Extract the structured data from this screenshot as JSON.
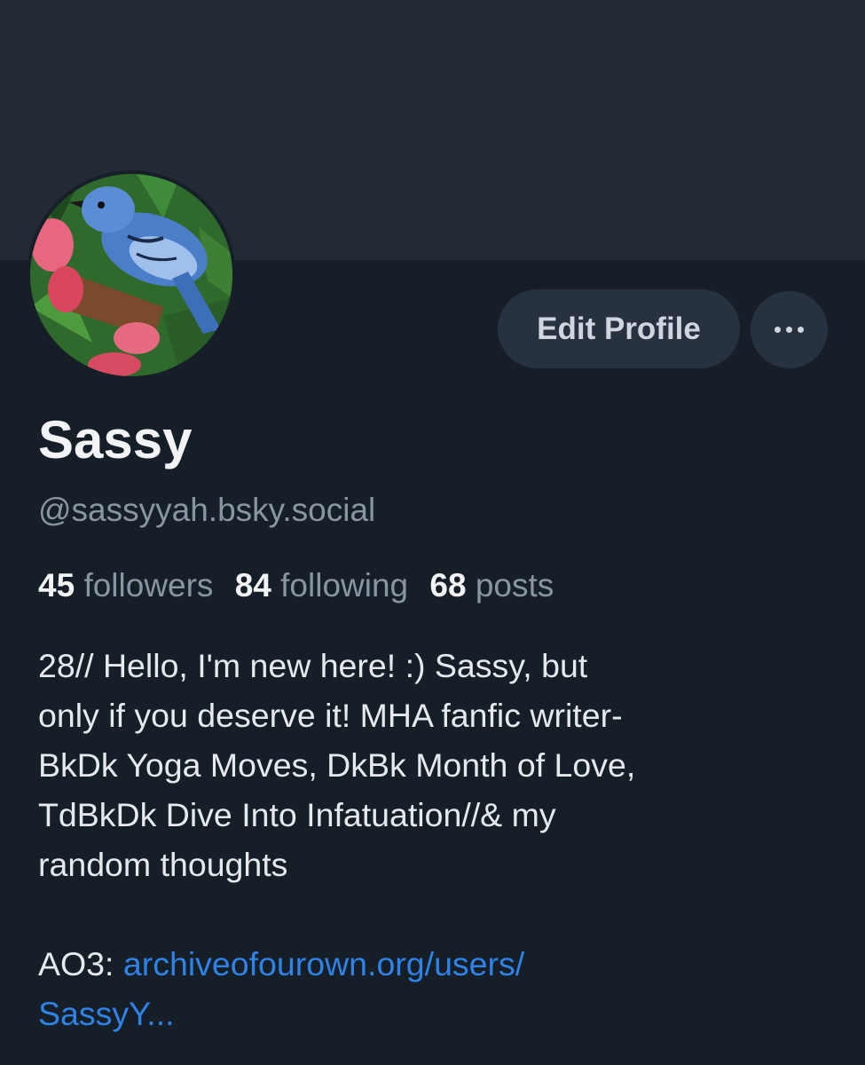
{
  "profile": {
    "display_name": "Sassy",
    "handle": "@sassyyah.bsky.social",
    "stats": {
      "followers_count": "45",
      "followers_label": "followers",
      "following_count": "84",
      "following_label": "following",
      "posts_count": "68",
      "posts_label": "posts"
    },
    "bio_lines": [
      "28// Hello, I'm new here! :) Sassy, but",
      "only if you deserve it! MHA fanfic writer-",
      "BkDk Yoga Moves, DkBk Month of Love,",
      "TdBkDk Dive Into Infatuation//& my",
      "random thoughts"
    ],
    "ao3_label": "AO3: ",
    "ao3_link_line1": "archiveofourown.org/users/",
    "ao3_link_line2": "SassyY..."
  },
  "actions": {
    "edit_profile_label": "Edit Profile",
    "more_icon": "ellipsis-icon"
  },
  "avatar": {
    "description_icon": "blue-jay-painting"
  },
  "colors": {
    "background": "#161e27",
    "banner": "#222a36",
    "button_bg": "#273140",
    "link": "#2f82e6",
    "muted_text": "#8a95a4"
  }
}
